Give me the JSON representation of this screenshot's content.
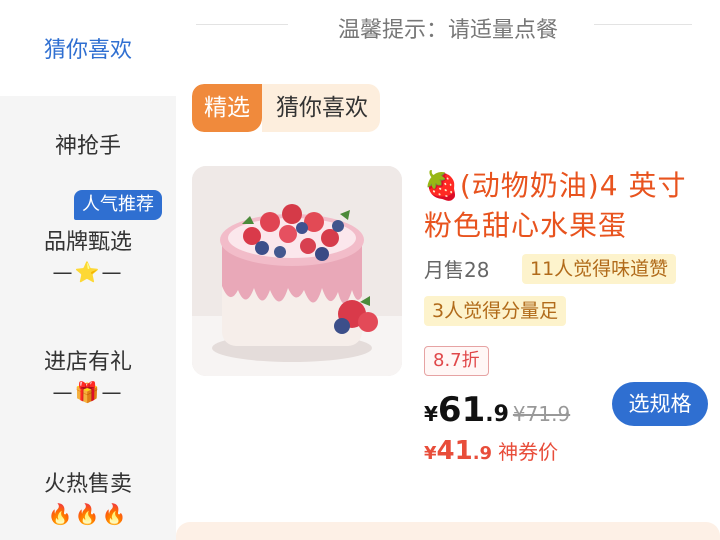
{
  "sidebar": {
    "active_label": "猜你喜欢",
    "items": [
      {
        "label": "神抢手",
        "sub": ""
      },
      {
        "label": "品牌甄选",
        "sub": "—⭐—"
      },
      {
        "label": "进店有礼",
        "sub": "—🎁—"
      },
      {
        "label": "火热售卖",
        "sub": "🔥🔥🔥"
      }
    ],
    "badge": "人气推荐"
  },
  "main": {
    "tip": "温馨提示：请适量点餐",
    "section_tag": "精选",
    "section_label": "猜你喜欢",
    "product": {
      "emoji": "🍓",
      "title": "(动物奶油)4 英寸粉色甜心水果蛋",
      "monthly_sales": "月售28",
      "tag_taste": "11人觉得味道赞",
      "tag_portion": "3人觉得分量足",
      "discount": "8.7折",
      "currency": "¥",
      "price_int": "61",
      "price_dec": ".9",
      "old_price": "¥71.9",
      "coupon_int": "41",
      "coupon_dec": ".9",
      "coupon_label": "神券价",
      "spec_button": "选规格"
    }
  },
  "colors": {
    "accent_blue": "#2f6fd1",
    "accent_orange": "#f08a3c",
    "price_red": "#e84d3a"
  }
}
